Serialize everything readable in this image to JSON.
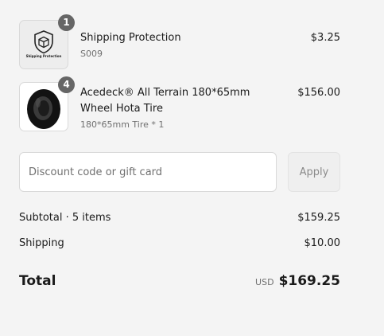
{
  "line_items": [
    {
      "title": "Shipping Protection",
      "subtitle": "S009",
      "price": "$3.25",
      "quantity": "1",
      "image_icon": "shield-package-icon",
      "image_caption": "Shipping Protection"
    },
    {
      "title": "Acedeck® All Terrain 180*65mm Wheel Hota Tire",
      "subtitle": "180*65mm Tire * 1",
      "price": "$156.00",
      "quantity": "4",
      "image_icon": "tire-icon"
    }
  ],
  "discount": {
    "placeholder": "Discount code or gift card",
    "apply_label": "Apply"
  },
  "summary": {
    "subtotal_label": "Subtotal · 5 items",
    "subtotal_value": "$159.25",
    "shipping_label": "Shipping",
    "shipping_value": "$10.00",
    "total_label": "Total",
    "currency": "USD",
    "total_value": "$169.25"
  }
}
